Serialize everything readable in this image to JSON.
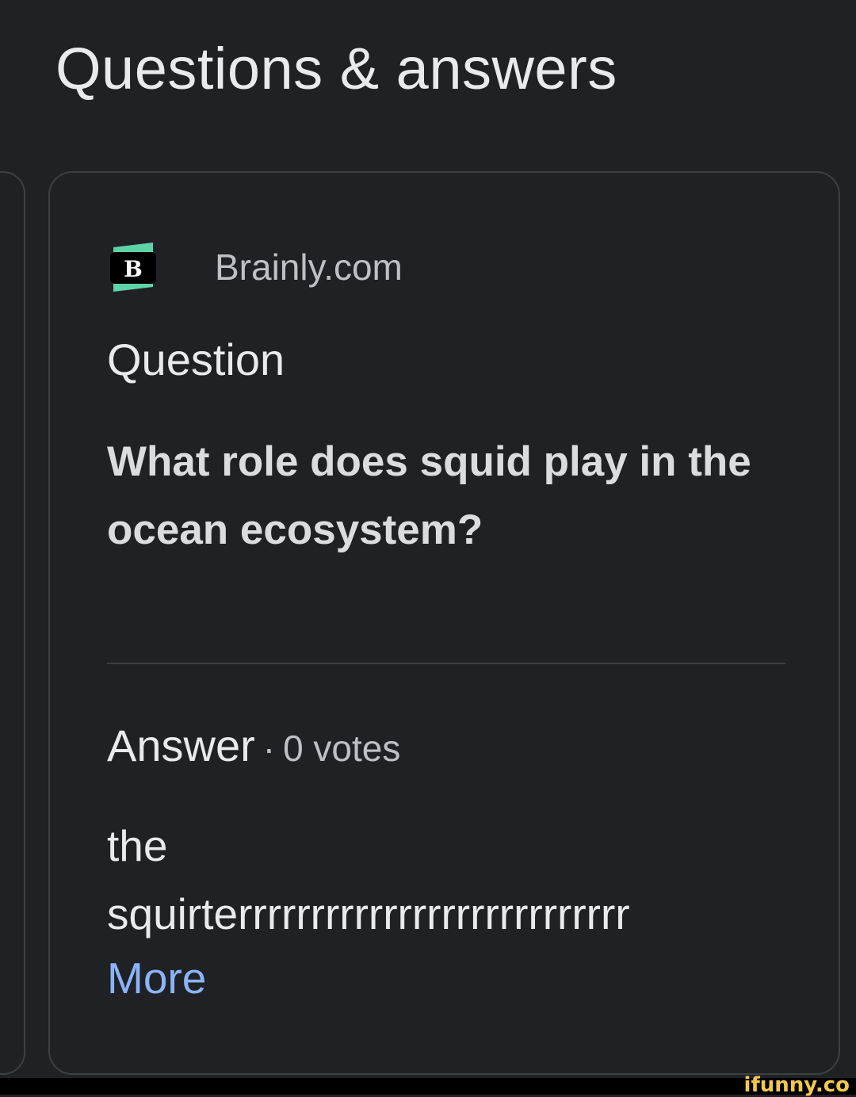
{
  "header": {
    "title": "Questions & answers"
  },
  "card": {
    "source": {
      "logo_icon": "brainly-logo-icon",
      "logo_letter": "B",
      "name": "Brainly.com"
    },
    "question_label": "Question",
    "question_text": "What role does squid play in the ocean ecosystem?",
    "answer": {
      "label": "Answer",
      "separator": "·",
      "votes": "0 votes",
      "lines": [
        "the",
        "squirterrrrrrrrrrrrrrrrrrrrrrrrrrr"
      ],
      "more_label": "More"
    }
  },
  "watermark": "ifunny.co",
  "colors": {
    "background": "#202124",
    "card_border": "#3c4043",
    "link": "#8ab4f8",
    "brainly_green": "#5fd3a8",
    "watermark": "#f2c94c"
  }
}
